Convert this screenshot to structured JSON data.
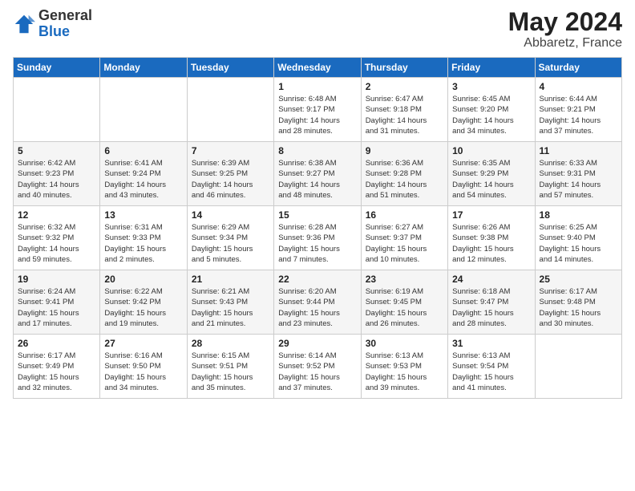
{
  "header": {
    "logo_general": "General",
    "logo_blue": "Blue",
    "title": "May 2024",
    "location": "Abbaretz, France"
  },
  "days_of_week": [
    "Sunday",
    "Monday",
    "Tuesday",
    "Wednesday",
    "Thursday",
    "Friday",
    "Saturday"
  ],
  "weeks": [
    [
      {
        "day": "",
        "info": ""
      },
      {
        "day": "",
        "info": ""
      },
      {
        "day": "",
        "info": ""
      },
      {
        "day": "1",
        "info": "Sunrise: 6:48 AM\nSunset: 9:17 PM\nDaylight: 14 hours\nand 28 minutes."
      },
      {
        "day": "2",
        "info": "Sunrise: 6:47 AM\nSunset: 9:18 PM\nDaylight: 14 hours\nand 31 minutes."
      },
      {
        "day": "3",
        "info": "Sunrise: 6:45 AM\nSunset: 9:20 PM\nDaylight: 14 hours\nand 34 minutes."
      },
      {
        "day": "4",
        "info": "Sunrise: 6:44 AM\nSunset: 9:21 PM\nDaylight: 14 hours\nand 37 minutes."
      }
    ],
    [
      {
        "day": "5",
        "info": "Sunrise: 6:42 AM\nSunset: 9:23 PM\nDaylight: 14 hours\nand 40 minutes."
      },
      {
        "day": "6",
        "info": "Sunrise: 6:41 AM\nSunset: 9:24 PM\nDaylight: 14 hours\nand 43 minutes."
      },
      {
        "day": "7",
        "info": "Sunrise: 6:39 AM\nSunset: 9:25 PM\nDaylight: 14 hours\nand 46 minutes."
      },
      {
        "day": "8",
        "info": "Sunrise: 6:38 AM\nSunset: 9:27 PM\nDaylight: 14 hours\nand 48 minutes."
      },
      {
        "day": "9",
        "info": "Sunrise: 6:36 AM\nSunset: 9:28 PM\nDaylight: 14 hours\nand 51 minutes."
      },
      {
        "day": "10",
        "info": "Sunrise: 6:35 AM\nSunset: 9:29 PM\nDaylight: 14 hours\nand 54 minutes."
      },
      {
        "day": "11",
        "info": "Sunrise: 6:33 AM\nSunset: 9:31 PM\nDaylight: 14 hours\nand 57 minutes."
      }
    ],
    [
      {
        "day": "12",
        "info": "Sunrise: 6:32 AM\nSunset: 9:32 PM\nDaylight: 14 hours\nand 59 minutes."
      },
      {
        "day": "13",
        "info": "Sunrise: 6:31 AM\nSunset: 9:33 PM\nDaylight: 15 hours\nand 2 minutes."
      },
      {
        "day": "14",
        "info": "Sunrise: 6:29 AM\nSunset: 9:34 PM\nDaylight: 15 hours\nand 5 minutes."
      },
      {
        "day": "15",
        "info": "Sunrise: 6:28 AM\nSunset: 9:36 PM\nDaylight: 15 hours\nand 7 minutes."
      },
      {
        "day": "16",
        "info": "Sunrise: 6:27 AM\nSunset: 9:37 PM\nDaylight: 15 hours\nand 10 minutes."
      },
      {
        "day": "17",
        "info": "Sunrise: 6:26 AM\nSunset: 9:38 PM\nDaylight: 15 hours\nand 12 minutes."
      },
      {
        "day": "18",
        "info": "Sunrise: 6:25 AM\nSunset: 9:40 PM\nDaylight: 15 hours\nand 14 minutes."
      }
    ],
    [
      {
        "day": "19",
        "info": "Sunrise: 6:24 AM\nSunset: 9:41 PM\nDaylight: 15 hours\nand 17 minutes."
      },
      {
        "day": "20",
        "info": "Sunrise: 6:22 AM\nSunset: 9:42 PM\nDaylight: 15 hours\nand 19 minutes."
      },
      {
        "day": "21",
        "info": "Sunrise: 6:21 AM\nSunset: 9:43 PM\nDaylight: 15 hours\nand 21 minutes."
      },
      {
        "day": "22",
        "info": "Sunrise: 6:20 AM\nSunset: 9:44 PM\nDaylight: 15 hours\nand 23 minutes."
      },
      {
        "day": "23",
        "info": "Sunrise: 6:19 AM\nSunset: 9:45 PM\nDaylight: 15 hours\nand 26 minutes."
      },
      {
        "day": "24",
        "info": "Sunrise: 6:18 AM\nSunset: 9:47 PM\nDaylight: 15 hours\nand 28 minutes."
      },
      {
        "day": "25",
        "info": "Sunrise: 6:17 AM\nSunset: 9:48 PM\nDaylight: 15 hours\nand 30 minutes."
      }
    ],
    [
      {
        "day": "26",
        "info": "Sunrise: 6:17 AM\nSunset: 9:49 PM\nDaylight: 15 hours\nand 32 minutes."
      },
      {
        "day": "27",
        "info": "Sunrise: 6:16 AM\nSunset: 9:50 PM\nDaylight: 15 hours\nand 34 minutes."
      },
      {
        "day": "28",
        "info": "Sunrise: 6:15 AM\nSunset: 9:51 PM\nDaylight: 15 hours\nand 35 minutes."
      },
      {
        "day": "29",
        "info": "Sunrise: 6:14 AM\nSunset: 9:52 PM\nDaylight: 15 hours\nand 37 minutes."
      },
      {
        "day": "30",
        "info": "Sunrise: 6:13 AM\nSunset: 9:53 PM\nDaylight: 15 hours\nand 39 minutes."
      },
      {
        "day": "31",
        "info": "Sunrise: 6:13 AM\nSunset: 9:54 PM\nDaylight: 15 hours\nand 41 minutes."
      },
      {
        "day": "",
        "info": ""
      }
    ]
  ]
}
